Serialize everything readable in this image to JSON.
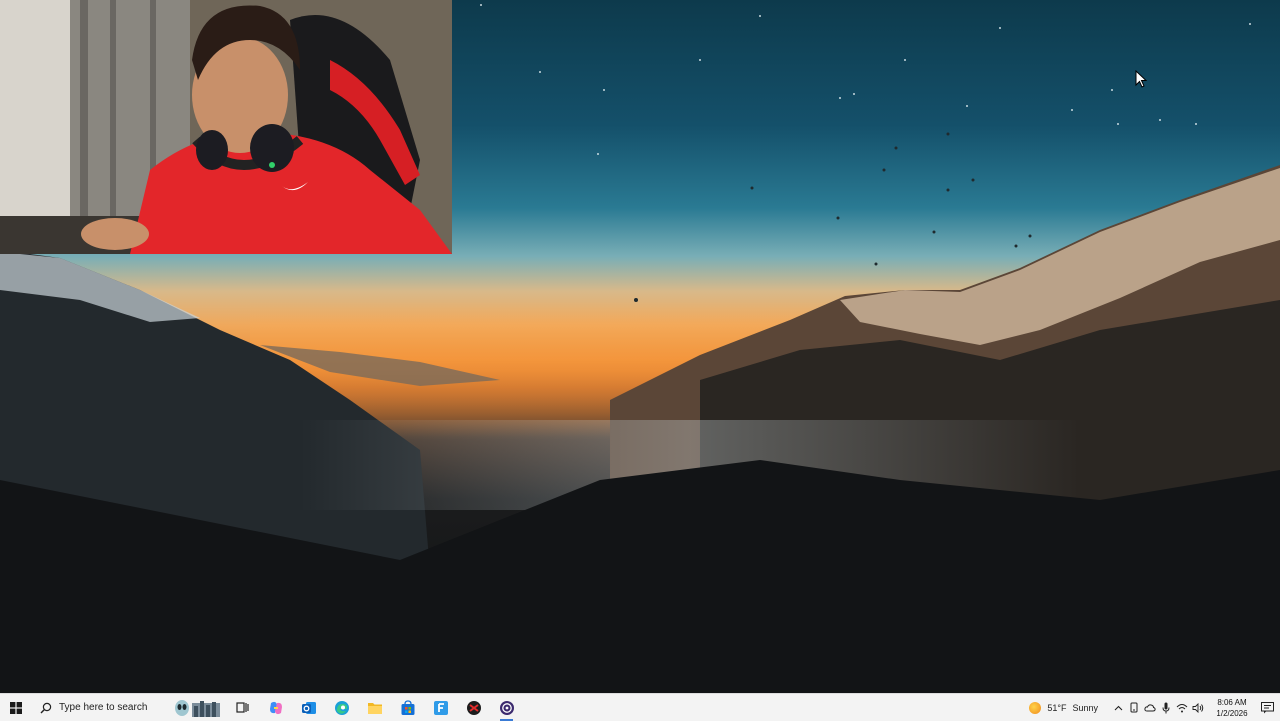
{
  "taskbar": {
    "search_placeholder": "Type here to search",
    "apps": [
      {
        "name": "task-view",
        "icon": "task-view-icon"
      },
      {
        "name": "copilot",
        "icon": "copilot-icon"
      },
      {
        "name": "outlook",
        "icon": "outlook-icon"
      },
      {
        "name": "edge",
        "icon": "edge-icon"
      },
      {
        "name": "file-explorer",
        "icon": "folder-icon"
      },
      {
        "name": "microsoft-store",
        "icon": "store-icon"
      },
      {
        "name": "app-f",
        "icon": "f-app-icon"
      },
      {
        "name": "roblox-like",
        "icon": "game-icon"
      },
      {
        "name": "obs",
        "icon": "obs-icon"
      }
    ],
    "weather": {
      "temp": "51°F",
      "condition": "Sunny"
    },
    "clock": {
      "time": "8:06 AM",
      "date": "1/2/2026"
    }
  },
  "colors": {
    "taskbar_bg": "#f3f3f3",
    "accent": "#3a7bd5"
  }
}
